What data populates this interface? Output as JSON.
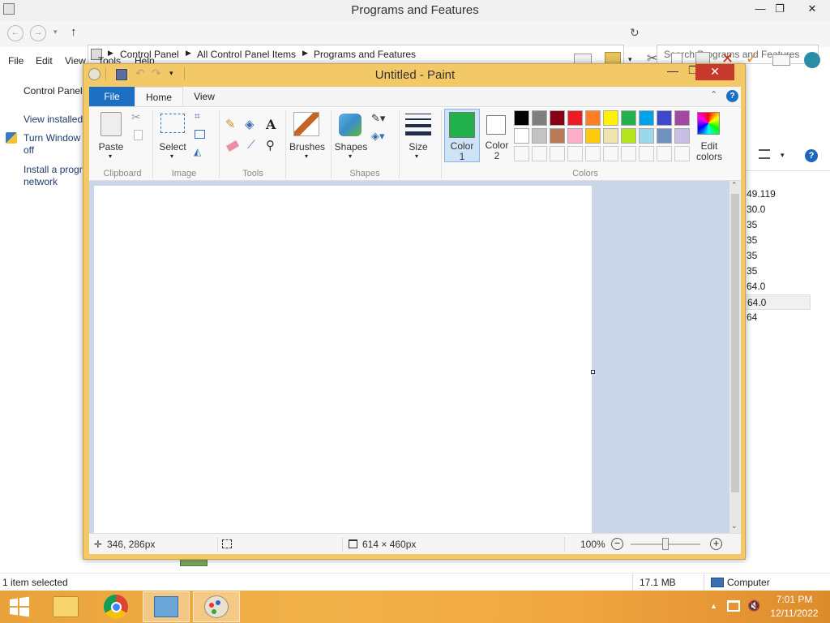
{
  "explorer": {
    "title": "Programs and Features",
    "window_controls": {
      "minimize": "—",
      "maximize": "❐",
      "close": "✕"
    },
    "breadcrumbs": [
      "Control Panel",
      "All Control Panel Items",
      "Programs and Features"
    ],
    "search_placeholder": "Search Programs and Features",
    "menu": [
      "File",
      "Edit",
      "View",
      "Tools",
      "Help"
    ],
    "left_panel": {
      "heading": "Control Panel",
      "links": [
        "View installed",
        "Turn Window\noff",
        "Install a progr\nnetwork"
      ]
    },
    "version_column": [
      "49.119",
      "30.0",
      "35",
      "35",
      "35",
      "35",
      "64.0",
      "64.0",
      "64"
    ],
    "status": {
      "selected": "1 item selected",
      "size": "17.1 MB",
      "location": "Computer"
    }
  },
  "paint": {
    "title": "Untitled - Paint",
    "tabs": {
      "file": "File",
      "home": "Home",
      "view": "View"
    },
    "groups": {
      "clipboard": "Clipboard",
      "image": "Image",
      "tools": "Tools",
      "shapes": "Shapes",
      "colors": "Colors"
    },
    "labels": {
      "paste": "Paste",
      "select": "Select",
      "brushes": "Brushes",
      "shapes": "Shapes",
      "size": "Size",
      "color1": "Color\n1",
      "color2": "Color\n2",
      "edit_colors": "Edit\ncolors"
    },
    "color1_value": "#22b14c",
    "color2_value": "#ffffff",
    "palette_row1": [
      "#000000",
      "#7f7f7f",
      "#880015",
      "#ed1c24",
      "#ff7f27",
      "#fff200",
      "#22b14c",
      "#00a2e8",
      "#3f48cc",
      "#a349a4"
    ],
    "palette_row2": [
      "#ffffff",
      "#c3c3c3",
      "#b97a57",
      "#ffaec9",
      "#ffc90e",
      "#efe4b0",
      "#b5e61d",
      "#99d9ea",
      "#7092be",
      "#c8bfe7"
    ],
    "status": {
      "cursor_pos": "346, 286px",
      "canvas_size": "614 × 460px",
      "zoom": "100%"
    }
  },
  "taskbar": {
    "time": "7:01 PM",
    "date": "12/11/2022"
  }
}
